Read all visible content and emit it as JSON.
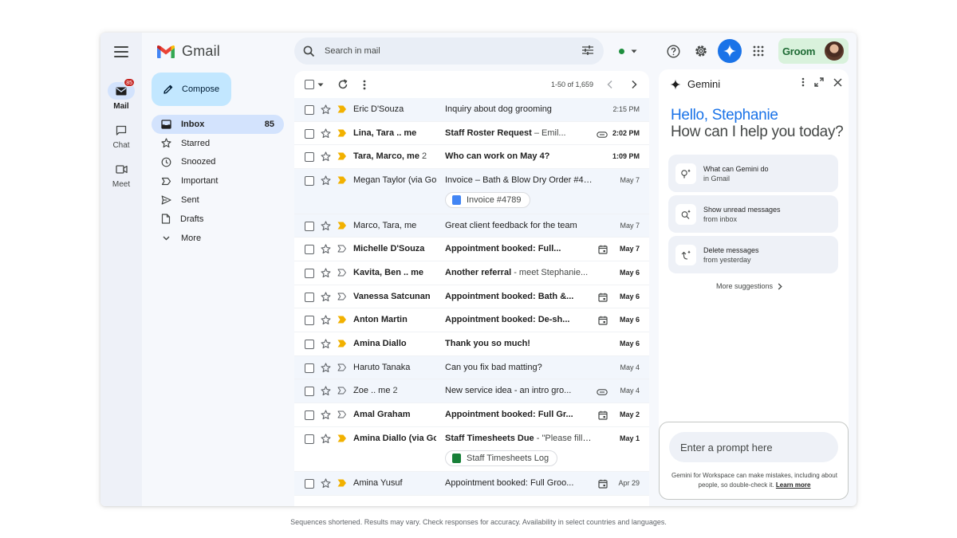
{
  "app": {
    "name": "Gmail",
    "brand_colors": {
      "blue": "#4285f4",
      "red": "#ea4335",
      "yellow": "#fbbc04",
      "green": "#34a853"
    }
  },
  "rail": {
    "items": [
      {
        "label": "Mail",
        "icon": "mail-icon",
        "badge": "85",
        "active": true
      },
      {
        "label": "Chat",
        "icon": "chat-icon"
      },
      {
        "label": "Meet",
        "icon": "video-icon"
      }
    ]
  },
  "compose": {
    "label": "Compose"
  },
  "nav": {
    "items": [
      {
        "label": "Inbox",
        "count": "85",
        "icon": "inbox-icon",
        "active": true
      },
      {
        "label": "Starred",
        "icon": "star-icon"
      },
      {
        "label": "Snoozed",
        "icon": "clock-icon"
      },
      {
        "label": "Important",
        "icon": "important-icon"
      },
      {
        "label": "Sent",
        "icon": "send-icon"
      },
      {
        "label": "Drafts",
        "icon": "draft-icon"
      },
      {
        "label": "More",
        "icon": "chevron-down-icon"
      }
    ]
  },
  "search": {
    "placeholder": "Search in mail"
  },
  "account": {
    "org_logo": "Groom"
  },
  "toolbar": {
    "pager": "1-50 of 1,659"
  },
  "emails": [
    {
      "sender": "Eric D'Souza",
      "subject": "Inquiry about dog grooming",
      "snippet": "",
      "date": "2:15 PM",
      "unread": false,
      "important": true
    },
    {
      "sender": "Lina, Tara .. me",
      "subject": "Staff Roster Request",
      "snippet": " – Emil...",
      "date": "2:02 PM",
      "unread": true,
      "important": true,
      "icon": "attachment"
    },
    {
      "sender": "Tara, Marco, me",
      "sender_count": "2",
      "subject": "Who can work on May 4?",
      "snippet": "",
      "date": "1:09 PM",
      "unread": true,
      "important": true
    },
    {
      "sender": "Megan Taylor (via Goo",
      "subject": "Invoice – Bath & Blow Dry Order #4789",
      "snippet": "",
      "date": "May 7",
      "unread": false,
      "important": true,
      "chip": "Invoice #4789",
      "chip_type": "doc"
    },
    {
      "sender": "Marco, Tara, me",
      "subject": "Great client feedback for the team",
      "snippet": "",
      "date": "May 7",
      "unread": false,
      "important": true
    },
    {
      "sender": "Michelle D'Souza",
      "subject": "Appointment booked: Full...",
      "snippet": "",
      "date": "May 7",
      "unread": true,
      "important": false,
      "icon": "calendar"
    },
    {
      "sender": "Kavita, Ben .. me",
      "subject": "Another referral",
      "snippet": " - meet Stephanie...",
      "date": "May 6",
      "unread": true,
      "important": false
    },
    {
      "sender": "Vanessa Satcunan",
      "subject": "Appointment booked: Bath &...",
      "snippet": "",
      "date": "May 6",
      "unread": true,
      "important": false,
      "icon": "calendar"
    },
    {
      "sender": "Anton Martin",
      "subject": "Appointment booked: De-sh...",
      "snippet": "",
      "date": "May 6",
      "unread": true,
      "important": true,
      "icon": "calendar"
    },
    {
      "sender": "Amina Diallo",
      "subject": "Thank you so much!",
      "snippet": "",
      "date": "May 6",
      "unread": true,
      "important": true
    },
    {
      "sender": "Haruto Tanaka",
      "subject": "Can you fix bad matting?",
      "snippet": "",
      "date": "May 4",
      "unread": false,
      "important": false
    },
    {
      "sender": "Zoe .. me",
      "sender_count": "2",
      "subject": "New service idea - an intro gro...",
      "snippet": "",
      "date": "May 4",
      "unread": false,
      "important": false,
      "icon": "attachment"
    },
    {
      "sender": "Amal Graham",
      "subject": "Appointment booked: Full Gr...",
      "snippet": "",
      "date": "May 2",
      "unread": true,
      "important": false,
      "icon": "calendar"
    },
    {
      "sender": "Amina Diallo (via Goo",
      "subject": "Staff Timesheets Due",
      "snippet": " - \"Please fill i...",
      "date": "May 1",
      "unread": true,
      "important": true,
      "chip": "Staff Timesheets Log",
      "chip_type": "sheet"
    },
    {
      "sender": "Amina Yusuf",
      "subject": "Appointment booked: Full Groo...",
      "snippet": "",
      "date": "Apr 29",
      "unread": false,
      "important": true,
      "icon": "calendar"
    }
  ],
  "gemini": {
    "title": "Gemini",
    "greeting": "Hello, Stephanie",
    "question": "How can I help you today?",
    "suggestions": [
      {
        "title": "What can Gemini do",
        "subtitle": "in Gmail",
        "icon": "lightbulb-sparkle-icon"
      },
      {
        "title": "Show unread messages",
        "subtitle": "from inbox",
        "icon": "search-sparkle-icon"
      },
      {
        "title": "Delete messages",
        "subtitle": "from yesterday",
        "icon": "undo-sparkle-icon"
      }
    ],
    "more_suggestions": "More suggestions",
    "prompt_placeholder": "Enter a prompt here",
    "disclaimer": "Gemini for Workspace can make mistakes, including about people, so double-check it.",
    "learn_more": "Learn more"
  },
  "footnote": "Sequences shortened. Results may vary. Check responses for accuracy. Availability in select countries and languages."
}
